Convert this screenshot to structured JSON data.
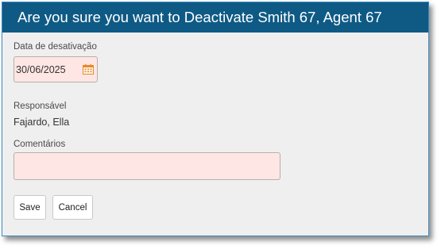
{
  "dialog": {
    "title": "Are you sure you want to Deactivate Smith 67, Agent 67"
  },
  "form": {
    "date_label": "Data de desativação",
    "date_value": "30/06/2025",
    "responsible_label": "Responsável",
    "responsible_value": "Fajardo, Ella",
    "comments_label": "Comentários",
    "comments_value": ""
  },
  "buttons": {
    "save_label": "Save",
    "cancel_label": "Cancel"
  },
  "icons": {
    "calendar": "calendar-icon"
  },
  "colors": {
    "title_bar": "#0e5a85",
    "required_field_bg": "#fde6e3",
    "calendar_icon": "#e8892a"
  }
}
